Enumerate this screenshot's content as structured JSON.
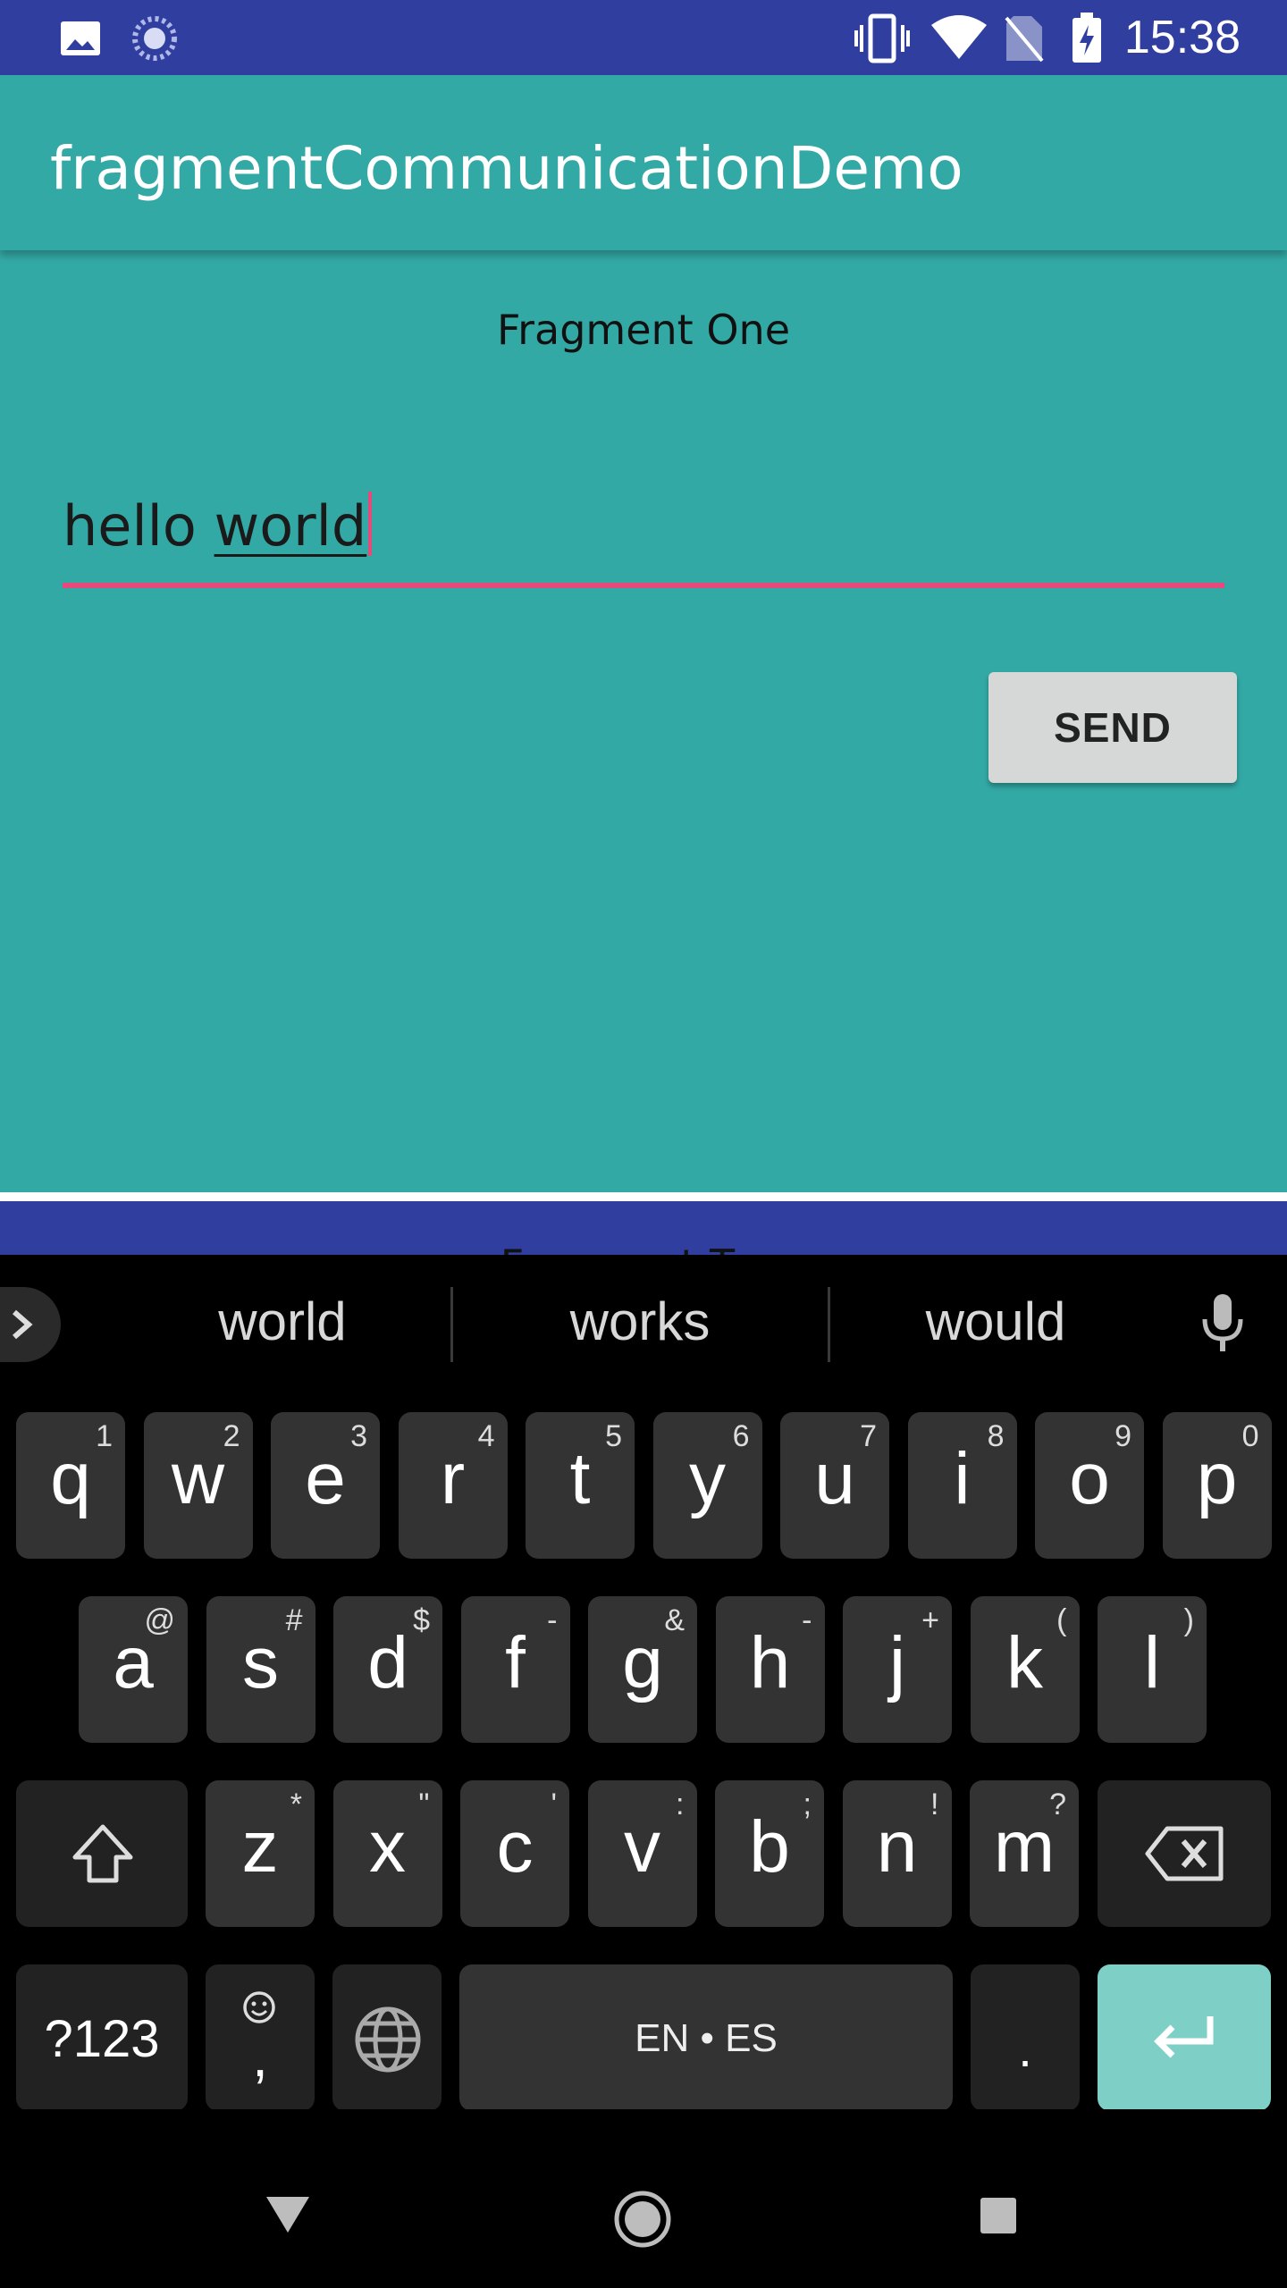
{
  "status_bar": {
    "time": "15:38",
    "icons": [
      "image-icon",
      "sync-icon",
      "vibrate-icon",
      "wifi-icon",
      "no-sim-icon",
      "battery-charging-icon"
    ]
  },
  "app_bar": {
    "title": "fragmentCommunicationDemo"
  },
  "fragment_one": {
    "title": "Fragment One",
    "input": {
      "value_plain": "hello ",
      "value_composing": "world"
    },
    "send_label": "SEND"
  },
  "fragment_two": {
    "title": "Fragment Two"
  },
  "keyboard": {
    "suggestions": [
      "world",
      "works",
      "would"
    ],
    "row1": [
      {
        "k": "q",
        "h": "1"
      },
      {
        "k": "w",
        "h": "2"
      },
      {
        "k": "e",
        "h": "3"
      },
      {
        "k": "r",
        "h": "4"
      },
      {
        "k": "t",
        "h": "5"
      },
      {
        "k": "y",
        "h": "6"
      },
      {
        "k": "u",
        "h": "7"
      },
      {
        "k": "i",
        "h": "8"
      },
      {
        "k": "o",
        "h": "9"
      },
      {
        "k": "p",
        "h": "0"
      }
    ],
    "row2": [
      {
        "k": "a",
        "h": "@"
      },
      {
        "k": "s",
        "h": "#"
      },
      {
        "k": "d",
        "h": "$"
      },
      {
        "k": "f",
        "h": "-"
      },
      {
        "k": "g",
        "h": "&"
      },
      {
        "k": "h",
        "h": "-"
      },
      {
        "k": "j",
        "h": "+"
      },
      {
        "k": "k",
        "h": "("
      },
      {
        "k": "l",
        "h": ")"
      }
    ],
    "row3": [
      {
        "k": "z",
        "h": "*"
      },
      {
        "k": "x",
        "h": "\""
      },
      {
        "k": "c",
        "h": "'"
      },
      {
        "k": "v",
        "h": ":"
      },
      {
        "k": "b",
        "h": ";"
      },
      {
        "k": "n",
        "h": "!"
      },
      {
        "k": "m",
        "h": "?"
      }
    ],
    "symbols_label": "?123",
    "comma_label": ",",
    "space_label": "EN • ES",
    "period_label": "."
  },
  "colors": {
    "status_bar": "#303F9F",
    "primary": "#33A9A6",
    "accent": "#E64A7A",
    "enter_key": "#7ECFC6"
  }
}
